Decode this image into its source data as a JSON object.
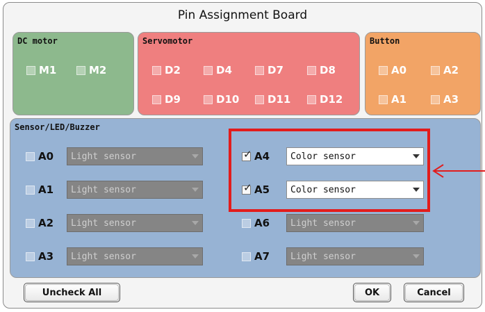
{
  "dialog": {
    "title": "Pin Assignment Board"
  },
  "dc_motor": {
    "title": "DC motor",
    "pins": [
      "M1",
      "M2"
    ],
    "color": "#8db98d"
  },
  "servomotor": {
    "title": "Servomotor",
    "pins": [
      "D2",
      "D4",
      "D7",
      "D8",
      "D9",
      "D10",
      "D11",
      "D12"
    ],
    "color": "#ef7f7f"
  },
  "button_group": {
    "title": "Button",
    "pins": [
      "A0",
      "A2",
      "A1",
      "A3"
    ],
    "color": "#f2a466"
  },
  "sensor": {
    "title": "Sensor/LED/Buzzer",
    "color": "#97b3d4",
    "rows": [
      {
        "pin": "A0",
        "value": "Light sensor",
        "checked": false
      },
      {
        "pin": "A1",
        "value": "Light sensor",
        "checked": false
      },
      {
        "pin": "A2",
        "value": "Light sensor",
        "checked": false
      },
      {
        "pin": "A3",
        "value": "Light sensor",
        "checked": false
      },
      {
        "pin": "A4",
        "value": "Color sensor",
        "checked": true
      },
      {
        "pin": "A5",
        "value": "Color sensor",
        "checked": true
      },
      {
        "pin": "A6",
        "value": "Light sensor",
        "checked": false
      },
      {
        "pin": "A7",
        "value": "Light sensor",
        "checked": false
      }
    ]
  },
  "footer": {
    "uncheck_all": "Uncheck All",
    "ok": "OK",
    "cancel": "Cancel"
  },
  "annotation": {
    "color": "#e21c1c",
    "arrow_icon": "left-arrow"
  },
  "checkmark": "✓"
}
